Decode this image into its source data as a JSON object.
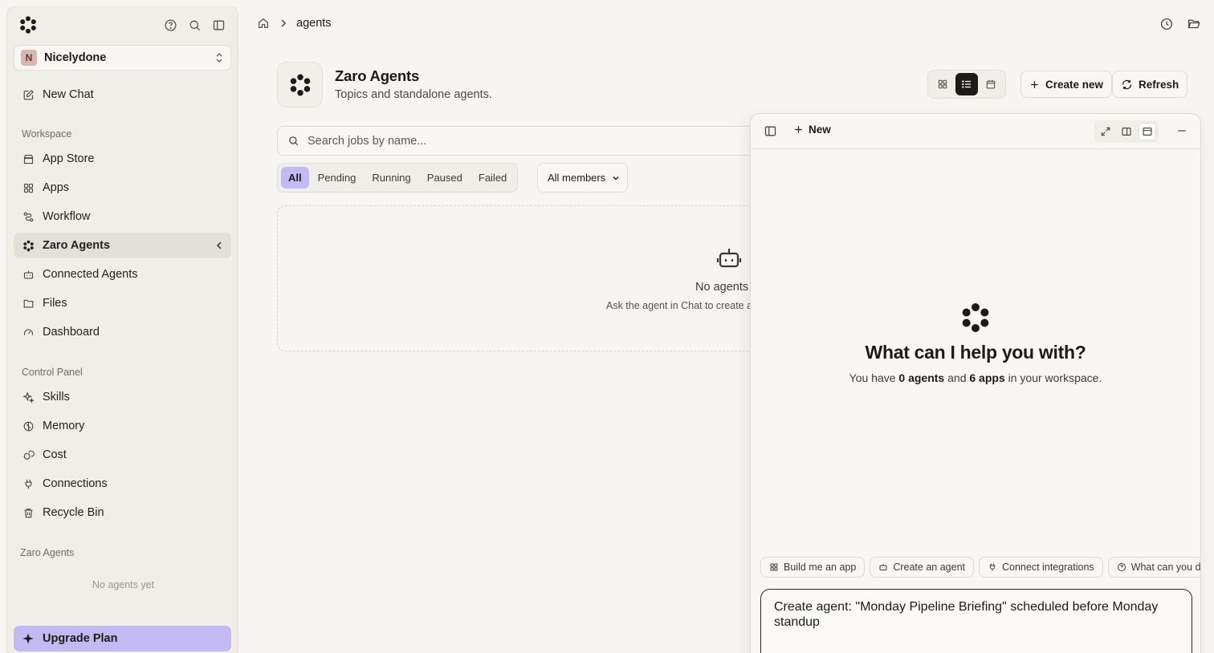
{
  "app": {
    "workspace": {
      "initial": "N",
      "name": "Nicelydone"
    }
  },
  "sidebar": {
    "new_chat": "New Chat",
    "workspace_label": "Workspace",
    "workspace_items": [
      {
        "label": "App Store",
        "icon": "store-icon"
      },
      {
        "label": "Apps",
        "icon": "grid-icon"
      },
      {
        "label": "Workflow",
        "icon": "workflow-icon"
      },
      {
        "label": "Zaro Agents",
        "icon": "flower-icon",
        "active": true
      },
      {
        "label": "Connected Agents",
        "icon": "bot-icon"
      },
      {
        "label": "Files",
        "icon": "folder-icon"
      },
      {
        "label": "Dashboard",
        "icon": "gauge-icon"
      }
    ],
    "control_label": "Control Panel",
    "control_items": [
      {
        "label": "Skills",
        "icon": "sparkle-icon"
      },
      {
        "label": "Memory",
        "icon": "brain-icon"
      },
      {
        "label": "Cost",
        "icon": "coins-icon"
      },
      {
        "label": "Connections",
        "icon": "plug-icon"
      },
      {
        "label": "Recycle Bin",
        "icon": "trash-icon"
      }
    ],
    "agents_label": "Zaro Agents",
    "agents_empty": "No agents yet",
    "upgrade": "Upgrade Plan"
  },
  "breadcrumb": {
    "current": "agents"
  },
  "header": {
    "title": "Zaro Agents",
    "subtitle": "Topics and standalone agents.",
    "create_label": "Create new",
    "refresh_label": "Refresh"
  },
  "search": {
    "placeholder": "Search jobs by name..."
  },
  "filters": {
    "tabs": [
      "All",
      "Pending",
      "Running",
      "Paused",
      "Failed"
    ],
    "selected": "All",
    "members": "All members"
  },
  "empty_state": {
    "title": "No agents y",
    "subtitle": "Ask the agent in Chat to create a t"
  },
  "chat": {
    "new_label": "New",
    "title": "What can I help you with?",
    "stats": {
      "prefix": "You have",
      "agents": "0 agents",
      "and": "and",
      "apps": "6 apps",
      "suffix": "in your workspace."
    },
    "suggestions": [
      {
        "label": "Build me an app",
        "icon": "grid-icon"
      },
      {
        "label": "Create an agent",
        "icon": "bot-icon"
      },
      {
        "label": "Connect integrations",
        "icon": "plug-icon"
      },
      {
        "label": "What can you d",
        "icon": "help-icon"
      }
    ],
    "composer_text": "Create agent: \"Monday Pipeline Briefing\" scheduled before Monday standup"
  },
  "colors": {
    "accent": "#c4baf3",
    "background": "#f6f5f1",
    "sidebar": "#efeee9",
    "dark": "#1d1b18"
  }
}
